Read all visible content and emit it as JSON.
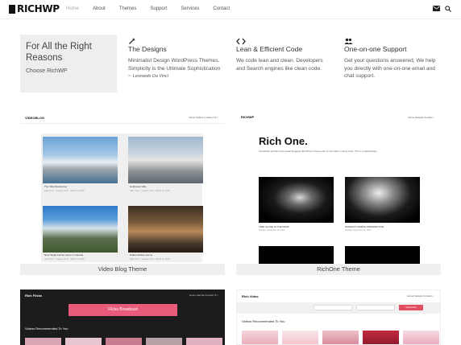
{
  "header": {
    "logo": "RICHWP",
    "nav": [
      "Home",
      "About",
      "Themes",
      "Support",
      "Services",
      "Contact"
    ],
    "icons": [
      "mail-icon",
      "search-icon"
    ]
  },
  "intro": {
    "headline": "For All the Right Reasons",
    "link": "Choose RichWP"
  },
  "features": [
    {
      "icon": "brush-icon",
      "title": "The Designs",
      "desc": "Minimalist Design WordPress Themes. Simplicity is the Ultimate Sophistication ~",
      "quote_author": "Leonardo Da Vinci"
    },
    {
      "icon": "code-icon",
      "title": "Lean & Efficient Code",
      "desc": "We code lean and clean. Developers and Search engines like clean code."
    },
    {
      "icon": "users-icon",
      "title": "One-on-one Support",
      "desc": "Get your questions answered, We help you directly with one-on-one email and chat support."
    }
  ],
  "themes": [
    {
      "caption": "Video Blog Theme",
      "brand": "VIDEOBLOG",
      "nav": "Home   Submit a Video   f   ✉   ⌕",
      "posts": [
        {
          "title": "The Villa Residences",
          "meta": "Sally Hurst · Category First · March 16, 2019"
        },
        {
          "title": "Hollywood Hills",
          "meta": "Sally Hurst · Category First · March 16, 2019"
        },
        {
          "title": "New Single Family Home in Canada",
          "meta": "Sally Hurst · Category First · March 16, 2019"
        },
        {
          "title": "Dallas Modern Home",
          "meta": "Sally Hurst · Category First · March 16, 2019"
        }
      ]
    },
    {
      "caption": "RichOne Theme",
      "brand": "RICHWP",
      "nav": "Home   Sample   Contact   ⌕",
      "hero": "Rich One.",
      "hero_sub": "A beautiful portfolio and visual blogging WordPress theme with a minimalist, moody style. This is a placeholder.",
      "posts": [
        {
          "title": "TIME ALONE IN THE DARK",
          "meta": "Monday, November 23, 2015"
        },
        {
          "title": "WOMAN'S SIMPLE PERSPECTIVE",
          "meta": "Monday, November 23, 2015"
        }
      ]
    },
    {
      "brand": "Rich Flicks",
      "nav": "Home   Sample   Contact   ✉   ⌕",
      "banner": "Flicks Broadcast",
      "section": "Videos Recommended To You"
    },
    {
      "brand": "Rich Video",
      "nav": "Home   Sample   Contact   ⌕",
      "button": "Subscribe",
      "section": "Videos Recommended To You"
    }
  ]
}
